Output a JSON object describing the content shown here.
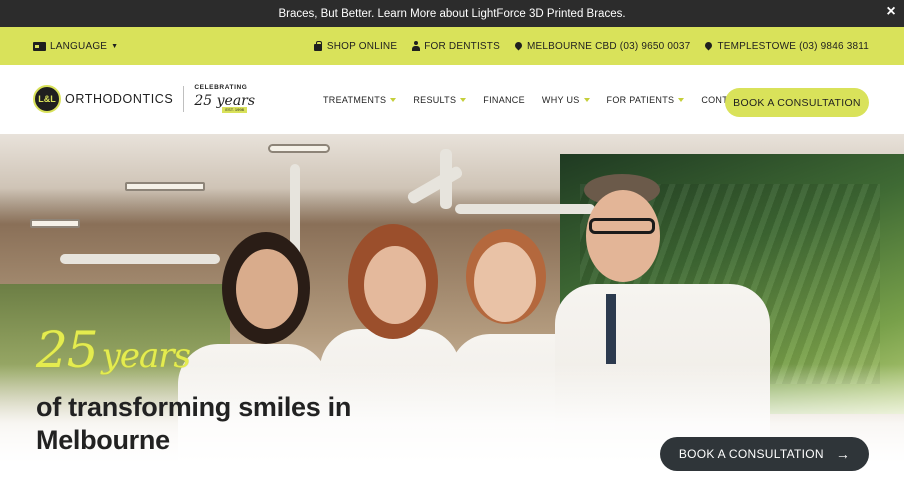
{
  "announcement": {
    "text": "Braces, But Better. Learn More about LightForce 3D Printed Braces.",
    "close_icon": "×"
  },
  "utility": {
    "language": "LANGUAGE",
    "links": [
      {
        "label": "SHOP ONLINE",
        "icon": "shopping-bag-icon"
      },
      {
        "label": "FOR DENTISTS",
        "icon": "person-icon"
      },
      {
        "label": "MELBOURNE CBD (03) 9650 0037",
        "icon": "location-pin-icon"
      },
      {
        "label": "TEMPLESTOWE (03) 9846 3811",
        "icon": "location-pin-icon"
      }
    ]
  },
  "header": {
    "logo_badge": "L&L",
    "logo_text": "ORTHODONTICS",
    "celebrating": "CELEBRATING",
    "years_script": "25 years",
    "est": "EST. 1998",
    "nav": [
      {
        "label": "TREATMENTS",
        "has_dropdown": true
      },
      {
        "label": "RESULTS",
        "has_dropdown": true
      },
      {
        "label": "FINANCE",
        "has_dropdown": false
      },
      {
        "label": "WHY US",
        "has_dropdown": true
      },
      {
        "label": "FOR PATIENTS",
        "has_dropdown": true
      },
      {
        "label": "CONTACT US",
        "has_dropdown": true
      }
    ],
    "cta": "BOOK A CONSULTATION"
  },
  "hero": {
    "script_number": "25",
    "script_word": "years",
    "headline": "of transforming smiles in Melbourne",
    "cta": "BOOK A CONSULTATION",
    "cta_arrow": "→"
  },
  "colors": {
    "accent": "#d9e25a",
    "dark": "#2c2c2c",
    "button_dark": "#2f3539"
  }
}
